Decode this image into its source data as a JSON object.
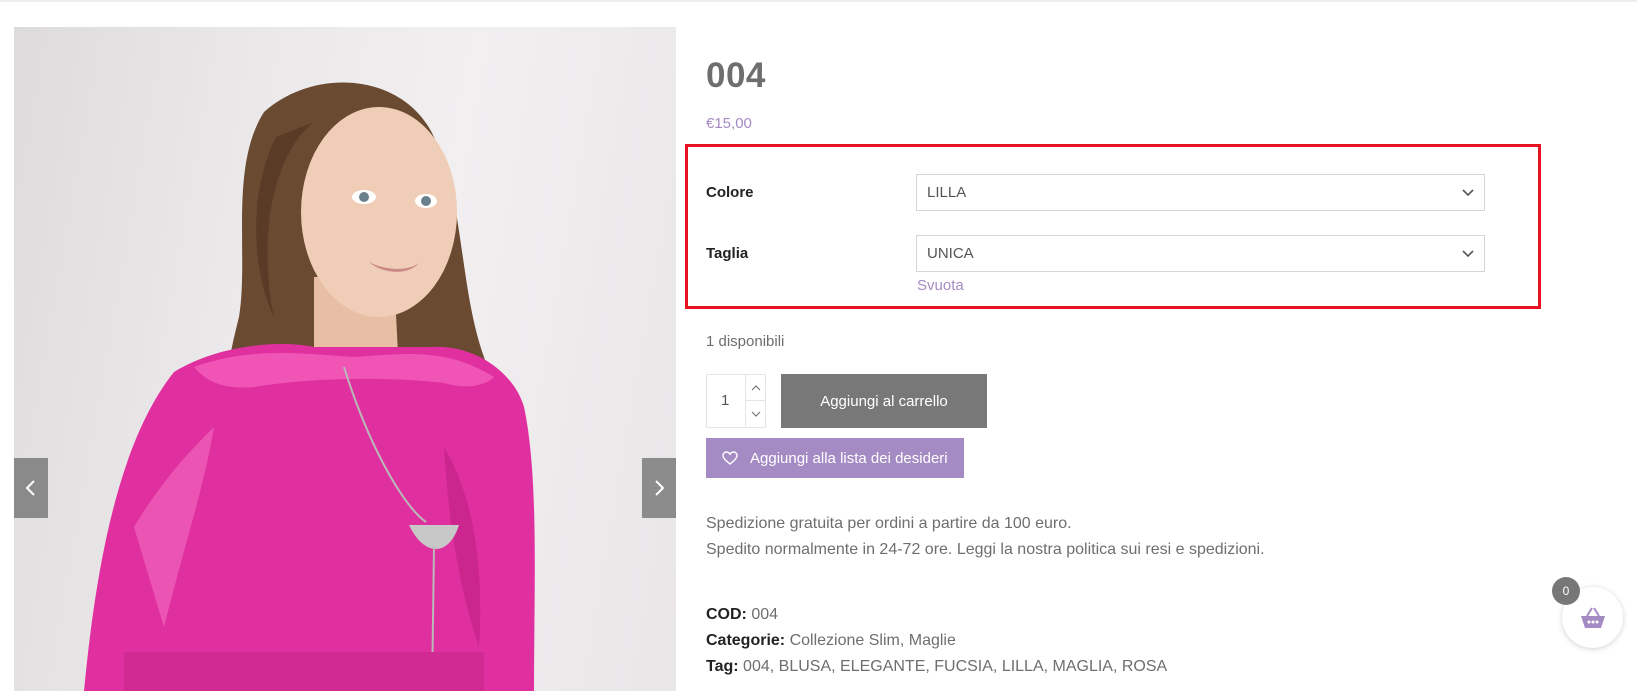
{
  "product": {
    "title": "004",
    "price": "€15,00",
    "stock": "1 disponibili"
  },
  "variations": [
    {
      "label": "Colore",
      "value": "LILLA"
    },
    {
      "label": "Taglia",
      "value": "UNICA"
    }
  ],
  "reset_label": "Svuota",
  "quantity": "1",
  "buttons": {
    "add_to_cart": "Aggiungi al carrello",
    "wishlist": "Aggiungi alla lista dei desideri"
  },
  "description": {
    "line1": "Spedizione gratuita per ordini a partire da 100 euro.",
    "line2": "Spedito normalmente in 24-72 ore. Leggi la nostra politica sui resi e spedizioni."
  },
  "meta": {
    "sku_label": "COD:",
    "sku": "004",
    "categories_label": "Categorie:",
    "categories": [
      "Collezione Slim",
      "Maglie"
    ],
    "tags_label": "Tag:",
    "tags": [
      "004",
      "BLUSA",
      "ELEGANTE",
      "FUCSIA",
      "LILLA",
      "MAGLIA",
      "ROSA"
    ]
  },
  "cart": {
    "count": "0"
  },
  "colors": {
    "accent": "#a58bc3",
    "button_gray": "#787878",
    "highlight": "#e8111f",
    "blouse": "#e0309f"
  },
  "icons": {
    "gallery_prev": "chevron-left-icon",
    "gallery_next": "chevron-right-icon",
    "select_arrow": "chevron-down-icon",
    "wishlist": "heart-icon",
    "cart": "basket-icon"
  }
}
